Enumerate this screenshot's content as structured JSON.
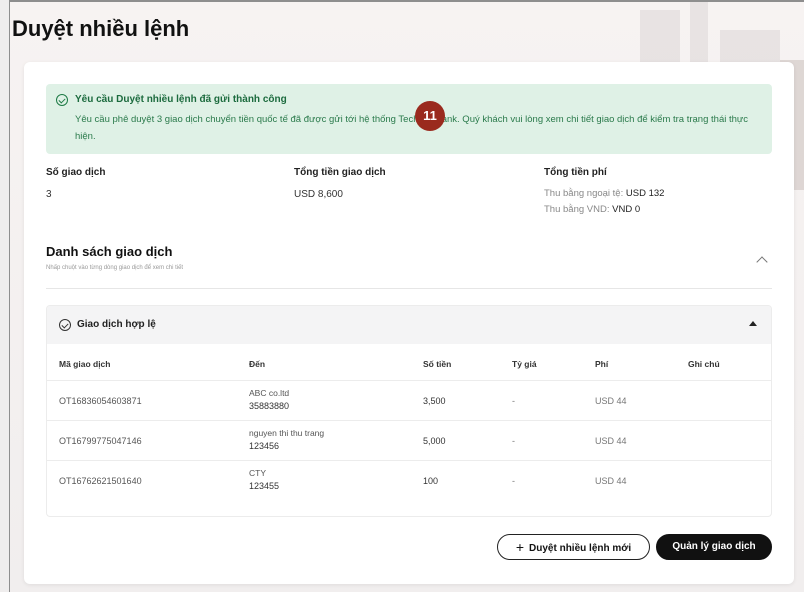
{
  "page": {
    "title": "Duyệt nhiều lệnh"
  },
  "success": {
    "title": "Yêu cầu Duyệt nhiều lệnh đã gửi thành công",
    "message": "Yêu cầu phê duyệt 3 giao dịch chuyển tiền quốc tế đã được gửi tới hệ thống Techcombank. Quý khách vui lòng xem chi tiết giao dịch để kiểm tra trạng thái thực hiện.",
    "icon": "check-circle-icon",
    "color": "#dff1e6"
  },
  "step_badge": "11",
  "summary": {
    "count_label": "Số giao dịch",
    "count_value": "3",
    "amount_label": "Tổng tiền giao dịch",
    "amount_value": "USD 8,600",
    "fee_label": "Tổng tiền phí",
    "fee_foreign_label": "Thu bằng ngoại tệ: ",
    "fee_foreign_value": "USD 132",
    "fee_vnd_label": "Thu bằng VND: ",
    "fee_vnd_value": "VND 0"
  },
  "list": {
    "title": "Danh sách giao dịch",
    "subtitle": "Nhấp chuột vào từng dòng giao dịch để xem chi tiết"
  },
  "group": {
    "label": "Giao dịch hợp lệ"
  },
  "table": {
    "headers": [
      "Mã giao dịch",
      "Đến",
      "Số tiền",
      "Tỷ giá",
      "Phí",
      "Ghi chú"
    ],
    "rows": [
      {
        "id": "OT16836054603871",
        "to_name": "ABC co.ltd",
        "to_account": "35883880",
        "amount": "3,500",
        "rate": "-",
        "fee": "USD 44",
        "note": ""
      },
      {
        "id": "OT16799775047146",
        "to_name": "nguyen thi thu trang",
        "to_account": "123456",
        "amount": "5,000",
        "rate": "-",
        "fee": "USD 44",
        "note": ""
      },
      {
        "id": "OT16762621501640",
        "to_name": "CTY",
        "to_account": "123455",
        "amount": "100",
        "rate": "-",
        "fee": "USD 44",
        "note": ""
      }
    ]
  },
  "actions": {
    "new_label": "Duyệt nhiều lệnh mới",
    "plus_symbol": "+",
    "manage_label": "Quản lý giao dịch"
  }
}
